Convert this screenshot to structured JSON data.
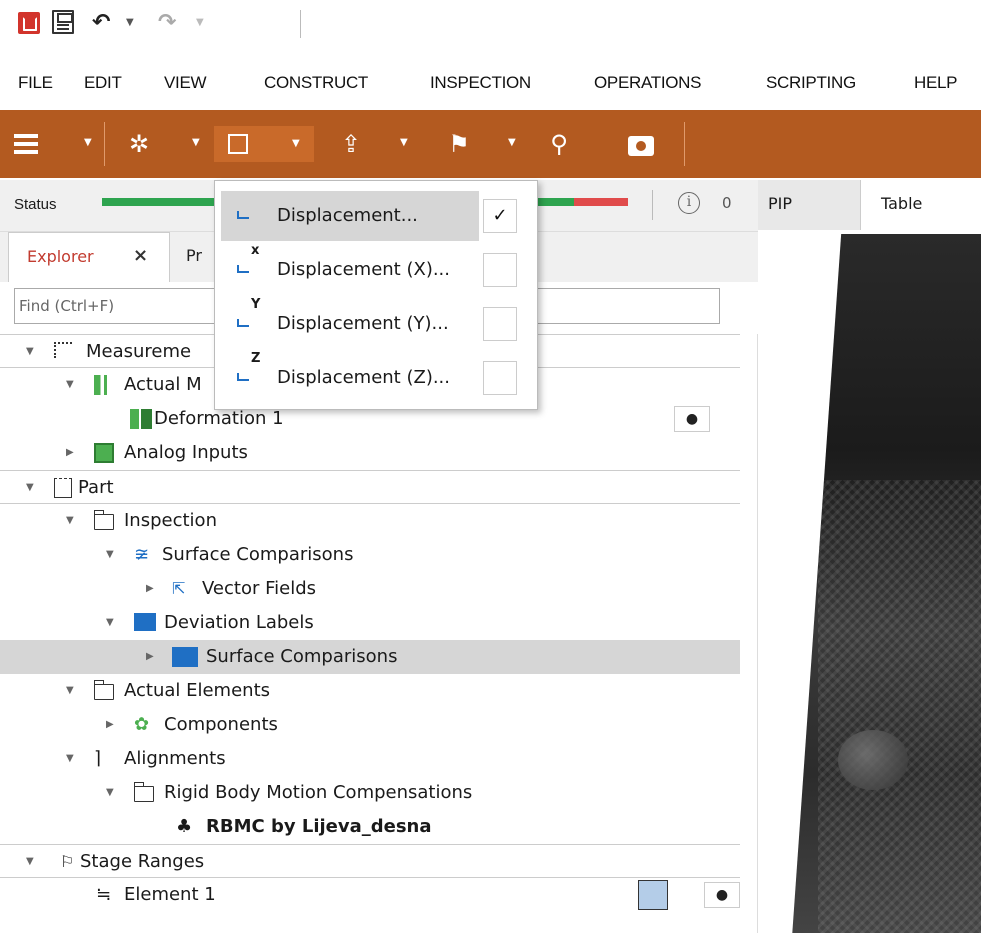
{
  "menubar": [
    "FILE",
    "EDIT",
    "VIEW",
    "CONSTRUCT",
    "INSPECTION",
    "OPERATIONS",
    "SCRIPTING",
    "HELP"
  ],
  "toolbar": {
    "icons": [
      "menu-icon",
      "construct-icon",
      "inspect-icon",
      "export-icon",
      "label-icon",
      "search-icon",
      "camera-icon"
    ],
    "accent": "#b35a20"
  },
  "status": {
    "label": "Status",
    "info_count": "0",
    "colors": {
      "ok": "#2ea44f",
      "error": "#e04b4b"
    }
  },
  "explorer": {
    "tab_label": "Explorer",
    "close": "×",
    "other_tab": "Pr",
    "search_placeholder": "Find (Ctrl+F)"
  },
  "tree": [
    {
      "label": "Measureme",
      "level": 0,
      "header": true
    },
    {
      "label": "Actual M",
      "level": 1
    },
    {
      "label": "Deformation 1",
      "level": 2,
      "eye": true
    },
    {
      "label": "Analog Inputs",
      "level": 1
    },
    {
      "label": "Part",
      "level": 0,
      "header": true
    },
    {
      "label": "Inspection",
      "level": 1
    },
    {
      "label": "Surface Comparisons",
      "level": 2
    },
    {
      "label": "Vector Fields",
      "level": 3
    },
    {
      "label": "Deviation Labels",
      "level": 2
    },
    {
      "label": "Surface Comparisons",
      "level": 3,
      "selected": true
    },
    {
      "label": "Actual Elements",
      "level": 1
    },
    {
      "label": "Components",
      "level": 2
    },
    {
      "label": "Alignments",
      "level": 1
    },
    {
      "label": "Rigid Body Motion Compensations",
      "level": 2
    },
    {
      "label": "RBMC by Lijeva_desna",
      "level": 3,
      "bold": true
    },
    {
      "label": "Stage Ranges",
      "level": 0,
      "header": true
    },
    {
      "label": "Element 1",
      "level": 1,
      "eye": true,
      "swatch": "#b4cde8"
    }
  ],
  "right_tabs": {
    "pip": "PIP",
    "table": "Table"
  },
  "dropdown": {
    "items": [
      {
        "label": "Displacement...",
        "sup": "",
        "checked": true
      },
      {
        "label": "Displacement (X)...",
        "sup": "x",
        "checked": false
      },
      {
        "label": "Displacement (Y)...",
        "sup": "Y",
        "checked": false
      },
      {
        "label": "Displacement (Z)...",
        "sup": "Z",
        "checked": false
      }
    ],
    "check_mark": "✓"
  }
}
